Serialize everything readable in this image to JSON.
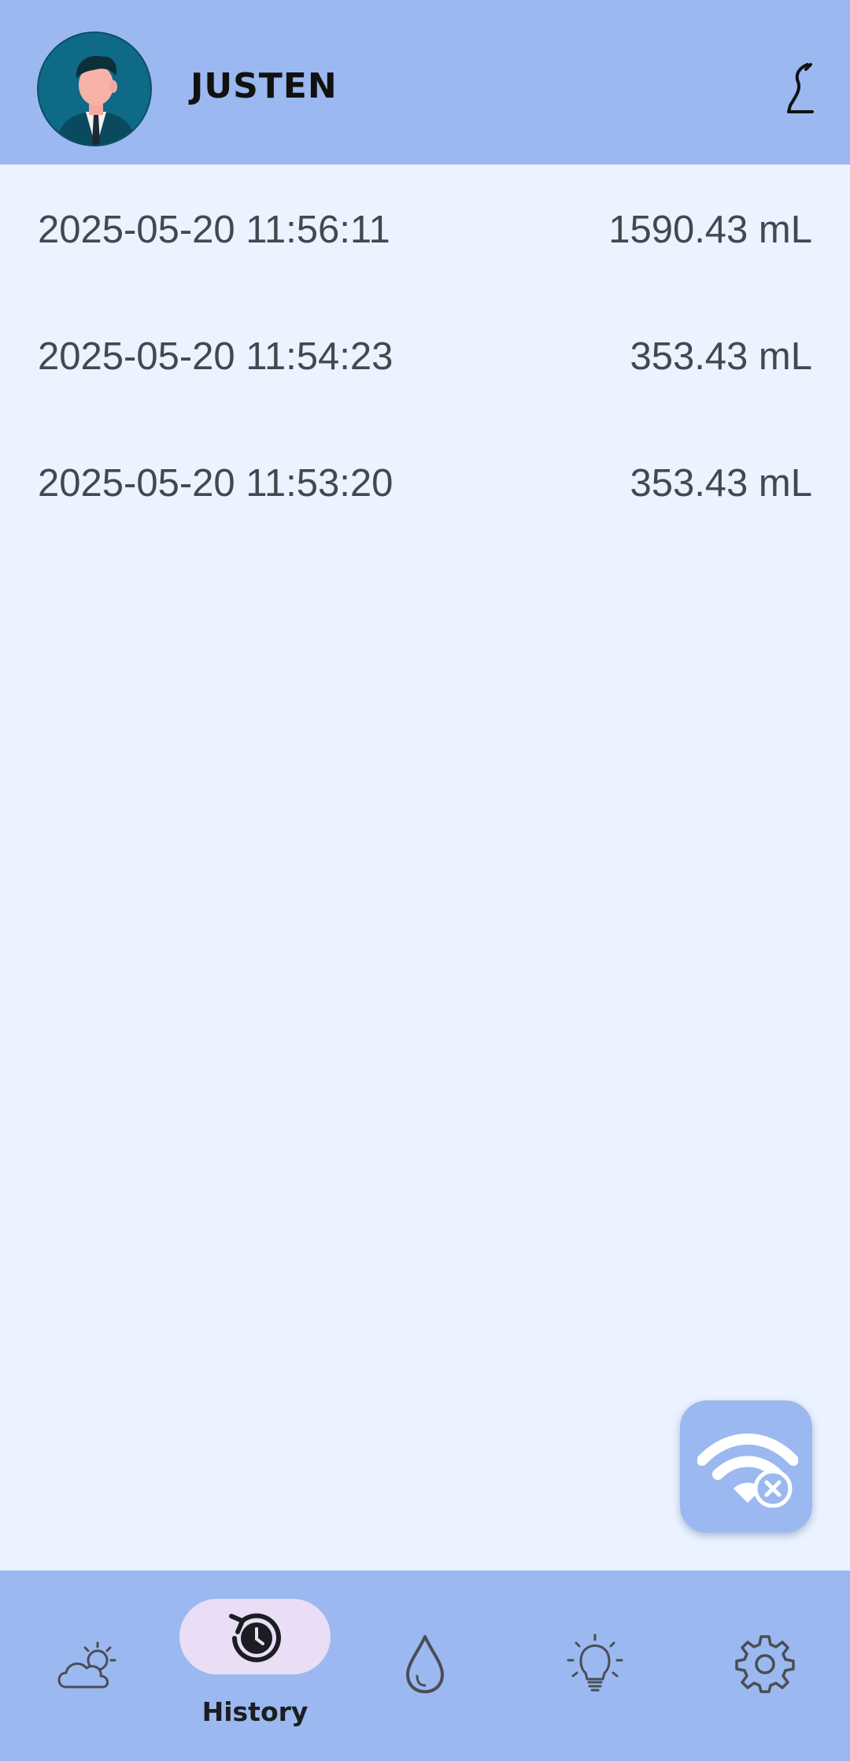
{
  "header": {
    "username": "JUSTEN",
    "avatar_icon": "person-avatar-icon",
    "logout_icon": "logout-icon"
  },
  "records": [
    {
      "timestamp": "2025-05-20 11:56:11",
      "volume": "1590.43 mL"
    },
    {
      "timestamp": "2025-05-20 11:54:23",
      "volume": "353.43 mL"
    },
    {
      "timestamp": "2025-05-20 11:53:20",
      "volume": "353.43 mL"
    }
  ],
  "fab": {
    "icon": "wifi-disconnected-icon"
  },
  "nav": {
    "items": [
      {
        "icon": "weather-icon"
      },
      {
        "icon": "history-icon",
        "label": "History",
        "active": true
      },
      {
        "icon": "water-drop-icon"
      },
      {
        "icon": "lightbulb-icon"
      },
      {
        "icon": "settings-icon"
      }
    ]
  },
  "colors": {
    "header_bg": "#9bb9f0",
    "page_bg": "#eaf3ff",
    "active_pill": "#e9def5",
    "avatar_bg": "#0e6a86"
  }
}
